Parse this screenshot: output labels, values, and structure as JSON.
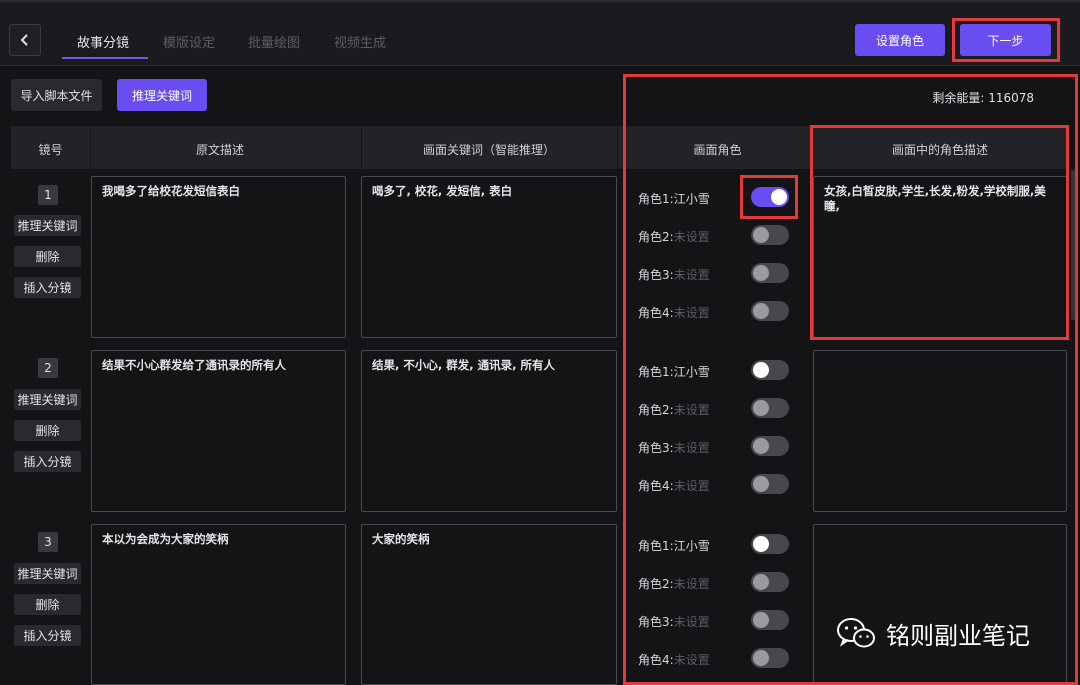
{
  "tabs": [
    {
      "label": "故事分镜"
    },
    {
      "label": "模版设定"
    },
    {
      "label": "批量绘图"
    },
    {
      "label": "视频生成"
    }
  ],
  "header": {
    "set_roles_label": "设置角色",
    "next_label": "下一步"
  },
  "toolbar": {
    "import_label": "导入脚本文件",
    "infer_label": "推理关键词"
  },
  "energy": {
    "label": "剩余能量:",
    "value": "116078"
  },
  "columns": {
    "index": "镜号",
    "original": "原文描述",
    "keywords": "画面关键词（智能推理）",
    "roles": "画面角色",
    "role_desc": "画面中的角色描述"
  },
  "row_actions": {
    "infer": "推理关键词",
    "delete": "删除",
    "insert": "插入分镜"
  },
  "rows": [
    {
      "index": "1",
      "original": "我喝多了给校花发短信表白",
      "keywords": "喝多了, 校花, 发短信, 表白",
      "role_desc": "女孩,白皙皮肤,学生,长发,粉发,学校制服,美瞳,",
      "roles": [
        {
          "name": "角色1:",
          "value": "江小雪",
          "on": true
        },
        {
          "name": "角色2:",
          "value": "未设置",
          "on": false
        },
        {
          "name": "角色3:",
          "value": "未设置",
          "on": false
        },
        {
          "name": "角色4:",
          "value": "未设置",
          "on": false
        }
      ]
    },
    {
      "index": "2",
      "original": "结果不小心群发给了通讯录的所有人",
      "keywords": "结果, 不小心, 群发, 通讯录, 所有人",
      "role_desc": "",
      "roles": [
        {
          "name": "角色1:",
          "value": "江小雪",
          "on": false
        },
        {
          "name": "角色2:",
          "value": "未设置",
          "on": false
        },
        {
          "name": "角色3:",
          "value": "未设置",
          "on": false
        },
        {
          "name": "角色4:",
          "value": "未设置",
          "on": false
        }
      ]
    },
    {
      "index": "3",
      "original": "本以为会成为大家的笑柄",
      "keywords": "大家的笑柄",
      "role_desc": "",
      "roles": [
        {
          "name": "角色1:",
          "value": "江小雪",
          "on": false
        },
        {
          "name": "角色2:",
          "value": "未设置",
          "on": false
        },
        {
          "name": "角色3:",
          "value": "未设置",
          "on": false
        },
        {
          "name": "角色4:",
          "value": "未设置",
          "on": false
        }
      ]
    }
  ],
  "watermark": {
    "text": "铭则副业笔记",
    "icon": "wechat-icon"
  }
}
